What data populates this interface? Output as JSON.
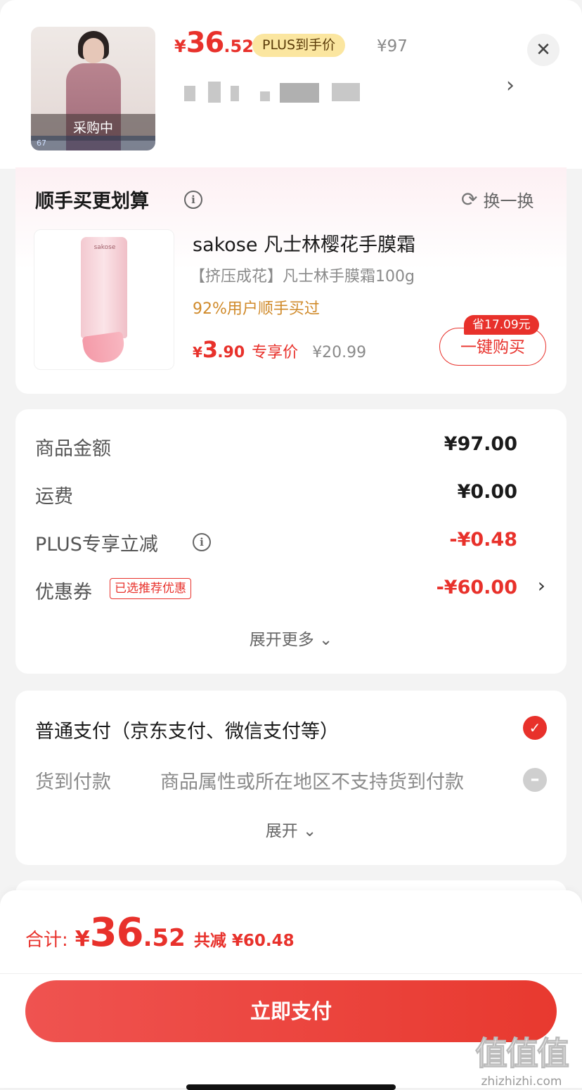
{
  "product": {
    "thumb_label": "采购中",
    "thumb_strip_number": "67",
    "price_currency": "¥",
    "price_int": "36",
    "price_dec": ".52",
    "plus_badge": "PLUS到手价",
    "original_price": "¥97",
    "close": "✕",
    "spec_chevron": "›"
  },
  "upsell": {
    "title": "顺手买更划算",
    "info": "i",
    "swap_icon": "⟳",
    "swap_label": "换一换",
    "image_brand": "sakose",
    "name": "sakose 凡士林樱花手膜霜",
    "subtitle": "【挤压成花】凡士林手膜霜100g",
    "hint": "92%用户顺手买过",
    "price_currency": "¥",
    "price_int": "3",
    "price_dec": ".90",
    "exclusive_label": "专享价",
    "original_price": "¥20.99",
    "save_tag": "省17.09元",
    "buy_label": "一键购买"
  },
  "summary": {
    "rows": [
      {
        "label": "商品金额",
        "value": "¥97.00"
      },
      {
        "label": "运费",
        "value": "¥0.00"
      },
      {
        "label": "PLUS专享立减",
        "value": "-¥0.48"
      },
      {
        "label": "优惠券",
        "value": "-¥60.00"
      }
    ],
    "info": "i",
    "coupon_tag": "已选推荐优惠",
    "chevron": "›",
    "expand_more": "展开更多 ⌄"
  },
  "payment": {
    "main_label": "普通支付（京东支付、微信支付等）",
    "check": "✓",
    "cod_label": "货到付款",
    "cod_note": "商品属性或所在地区不支持货到付款",
    "minus": "–",
    "expand": "展开 ⌄"
  },
  "footer": {
    "total_label": "合计:",
    "total_currency": "¥",
    "total_int": "36",
    "total_dec": ".52",
    "saved": "共减 ¥60.48",
    "pay_label": "立即支付",
    "watermark_logo": "值值值",
    "watermark_url": "zhizhizhi.com"
  },
  "colors": {
    "accent": "#e8312b",
    "plus_badge_bg": "#fbe6a0",
    "hint_orange": "#d08a2a"
  }
}
